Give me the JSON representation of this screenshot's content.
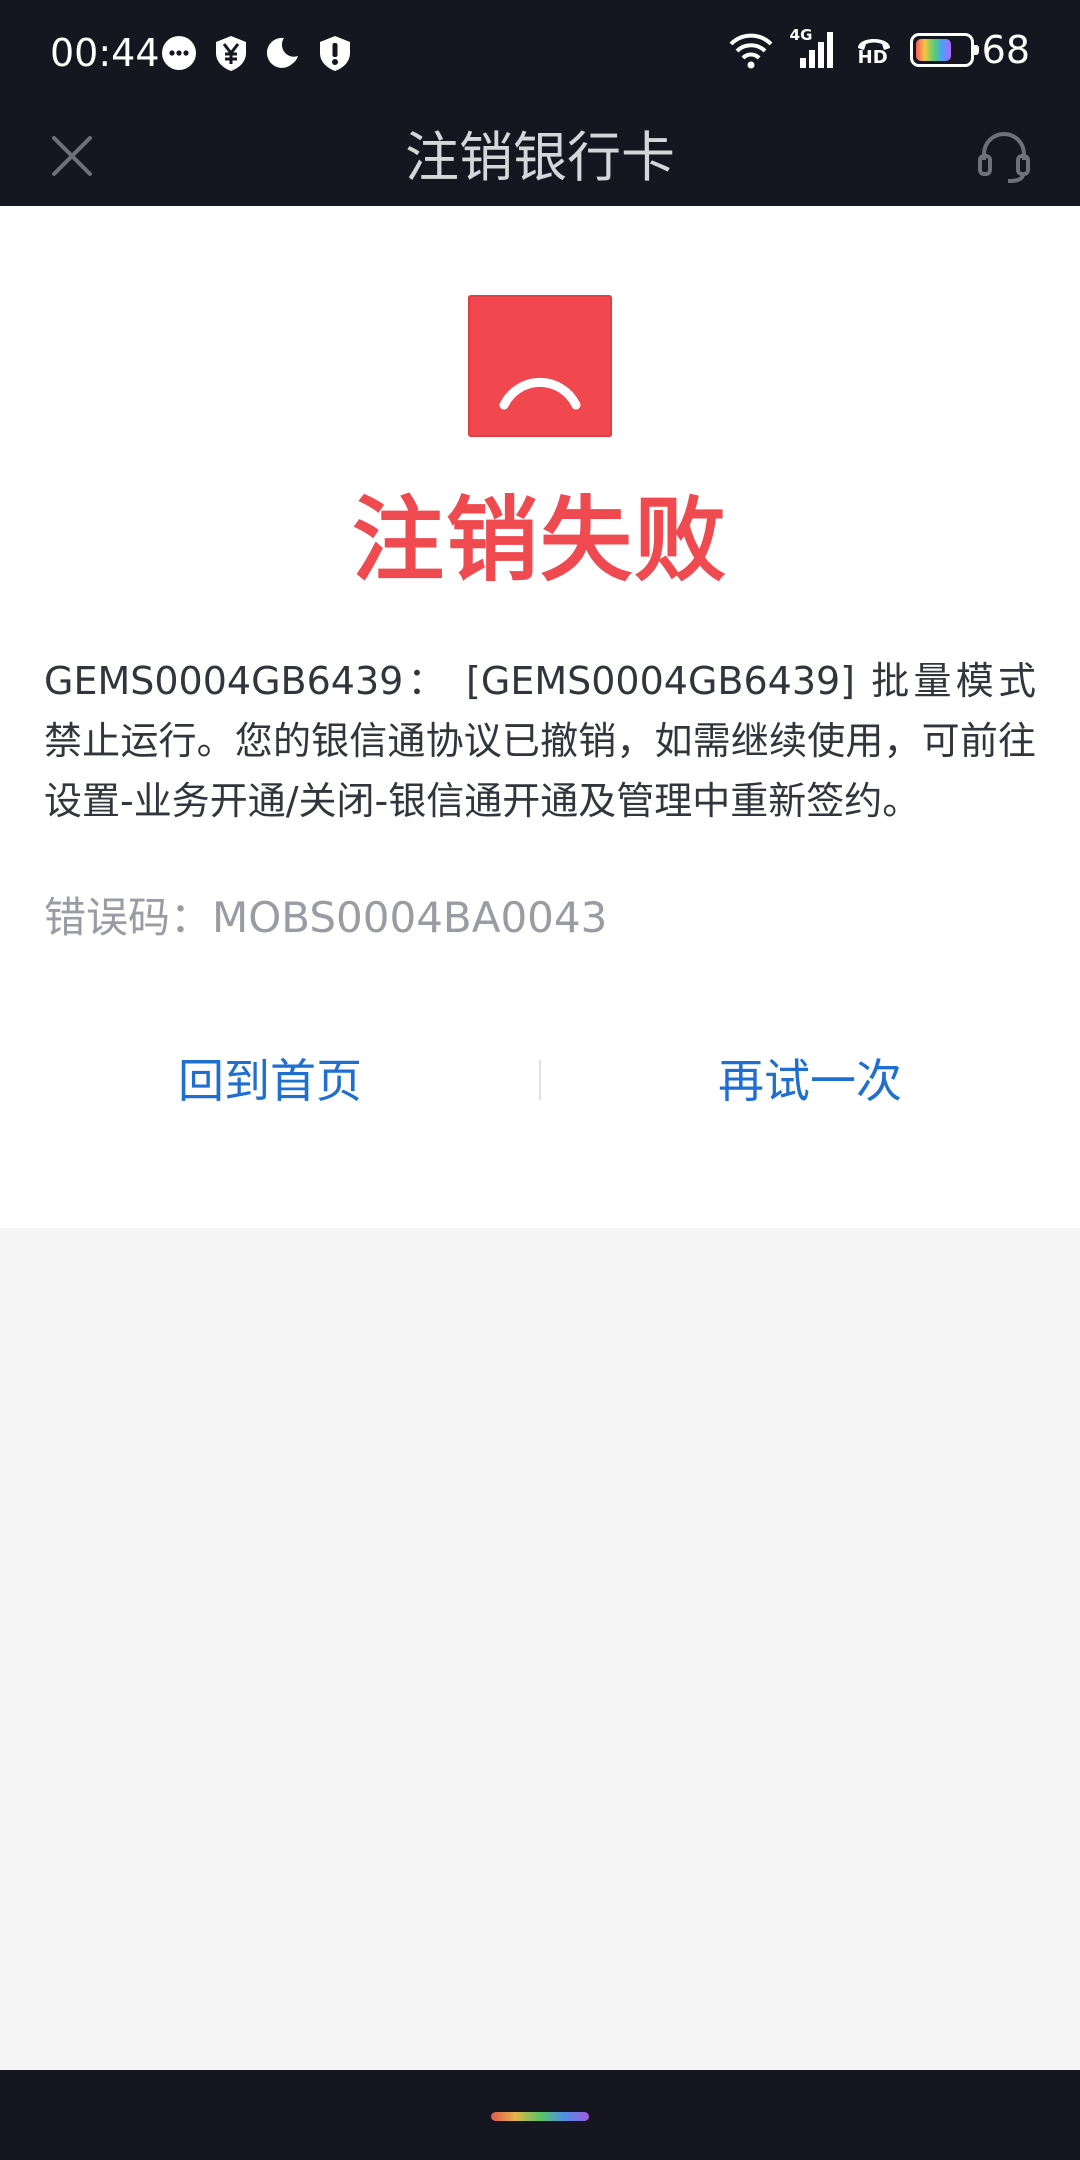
{
  "status_bar": {
    "time": "00:44",
    "icons_left": [
      "chat-bubble-icon",
      "yuan-shield-icon",
      "moon-icon",
      "alert-shield-icon"
    ],
    "network_label": "4G",
    "hd_label": "HD",
    "battery_level": "68"
  },
  "nav": {
    "title": "注销银行卡",
    "close_icon": "close-icon",
    "support_icon": "headset-icon"
  },
  "result": {
    "title": "注销失败",
    "message": "GEMS0004GB6439： [GEMS0004GB6439] 批量模式禁止运行。您的银信通协议已撤销，如需继续使用，可前往设置-业务开通/关闭-银信通开通及管理中重新签约。",
    "error_code": "错误码：MOBS0004BA0043"
  },
  "actions": {
    "home_label": "回到首页",
    "retry_label": "再试一次"
  },
  "colors": {
    "accent_blue": "#1f6fd0",
    "error_red": "#ee4a50",
    "dark_bar": "#15161f"
  }
}
